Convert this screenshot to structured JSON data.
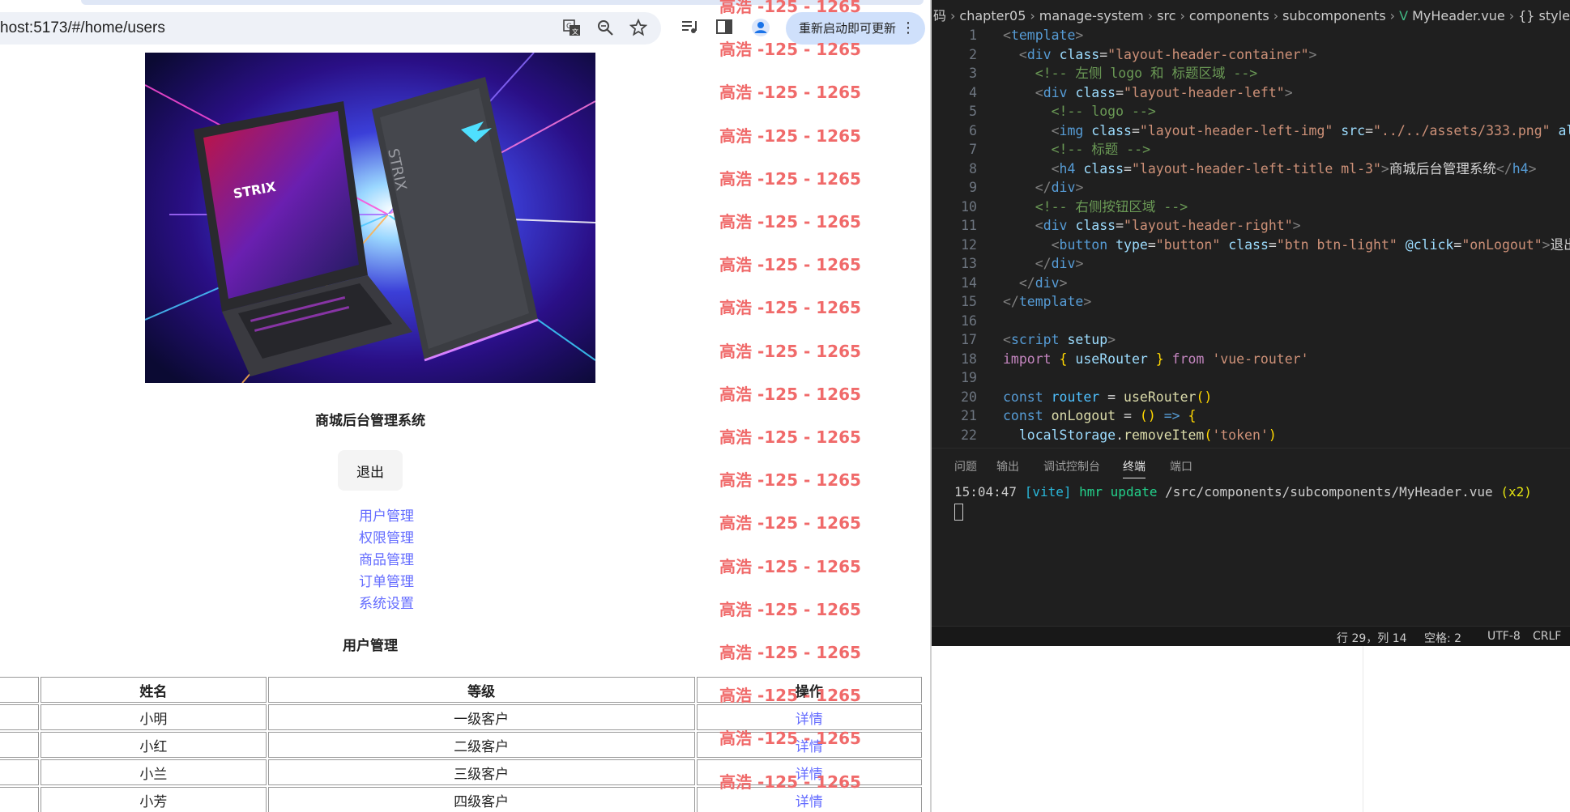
{
  "browser": {
    "url": "host:5173/#/home/users",
    "restart_label": "重新启动即可更新",
    "toolbar_icons": [
      "translate-icon",
      "zoom-icon",
      "star-icon",
      "media-icon",
      "sidebar-icon",
      "profile-icon",
      "more-icon"
    ]
  },
  "page": {
    "site_title": "商城后台管理系统",
    "logout_label": "退出",
    "menu": [
      "用户管理",
      "权限管理",
      "商品管理",
      "订单管理",
      "系统设置"
    ],
    "section_title": "用户管理",
    "table": {
      "headers": [
        "",
        "姓名",
        "等级",
        "操作"
      ],
      "rows": [
        {
          "id": "",
          "name": "小明",
          "level": "一级客户",
          "op": "详情"
        },
        {
          "id": "",
          "name": "小红",
          "level": "二级客户",
          "op": "详情"
        },
        {
          "id": "",
          "name": "小兰",
          "level": "三级客户",
          "op": "详情"
        },
        {
          "id": "",
          "name": "小芳",
          "level": "四级客户",
          "op": "详情"
        }
      ]
    }
  },
  "watermark": {
    "text": "高浩 -125 - 1265",
    "color": "#f06a6a"
  },
  "vscode": {
    "breadcrumb": [
      "码",
      "chapter05",
      "manage-system",
      "src",
      "components",
      "subcomponents",
      "MyHeader.vue",
      "{} style"
    ],
    "code_lines": [
      {
        "n": "1",
        "html": "<span class='t-punc'>&lt;</span><span class='t-tag'>template</span><span class='t-punc'>&gt;</span>"
      },
      {
        "n": "2",
        "html": "  <span class='t-punc'>&lt;</span><span class='t-tag'>div</span> <span class='t-attr'>class</span>=<span class='t-str'>\"layout-header-container\"</span><span class='t-punc'>&gt;</span>"
      },
      {
        "n": "3",
        "html": "    <span class='t-cmt'>&lt;!-- 左侧 logo 和 标题区域 --&gt;</span>"
      },
      {
        "n": "4",
        "html": "    <span class='t-punc'>&lt;</span><span class='t-tag'>div</span> <span class='t-attr'>class</span>=<span class='t-str'>\"layout-header-left\"</span><span class='t-punc'>&gt;</span>"
      },
      {
        "n": "5",
        "html": "      <span class='t-cmt'>&lt;!-- logo --&gt;</span>"
      },
      {
        "n": "6",
        "html": "      <span class='t-punc'>&lt;</span><span class='t-tag'>img</span> <span class='t-attr'>class</span>=<span class='t-str'>\"layout-header-left-img\"</span> <span class='t-attr'>src</span>=<span class='t-str'>\"../../assets/333.png\"</span> <span class='t-attr'>alt</span>="
      },
      {
        "n": "7",
        "html": "      <span class='t-cmt'>&lt;!-- 标题 --&gt;</span>"
      },
      {
        "n": "8",
        "html": "      <span class='t-punc'>&lt;</span><span class='t-tag'>h4</span> <span class='t-attr'>class</span>=<span class='t-str'>\"layout-header-left-title ml-3\"</span><span class='t-punc'>&gt;</span>商城后台管理系统<span class='t-punc'>&lt;/</span><span class='t-tag'>h4</span><span class='t-punc'>&gt;</span>"
      },
      {
        "n": "9",
        "html": "    <span class='t-punc'>&lt;/</span><span class='t-tag'>div</span><span class='t-punc'>&gt;</span>"
      },
      {
        "n": "10",
        "html": "    <span class='t-cmt'>&lt;!-- 右侧按钮区域 --&gt;</span>"
      },
      {
        "n": "11",
        "html": "    <span class='t-punc'>&lt;</span><span class='t-tag'>div</span> <span class='t-attr'>class</span>=<span class='t-str'>\"layout-header-right\"</span><span class='t-punc'>&gt;</span>"
      },
      {
        "n": "12",
        "html": "      <span class='t-punc'>&lt;</span><span class='t-tag'>button</span> <span class='t-attr'>type</span>=<span class='t-str'>\"button\"</span> <span class='t-attr'>class</span>=<span class='t-str'>\"btn btn-light\"</span> <span class='t-attr'>@click</span>=<span class='t-str'>\"onLogout\"</span><span class='t-punc'>&gt;</span>退出<span class='t-punc'>&lt;</span>"
      },
      {
        "n": "13",
        "html": "    <span class='t-punc'>&lt;/</span><span class='t-tag'>div</span><span class='t-punc'>&gt;</span>"
      },
      {
        "n": "14",
        "html": "  <span class='t-punc'>&lt;/</span><span class='t-tag'>div</span><span class='t-punc'>&gt;</span>"
      },
      {
        "n": "15",
        "html": "<span class='t-punc'>&lt;/</span><span class='t-tag'>template</span><span class='t-punc'>&gt;</span>"
      },
      {
        "n": "16",
        "html": ""
      },
      {
        "n": "17",
        "html": "<span class='t-punc'>&lt;</span><span class='t-tag'>script</span> <span class='t-attr'>setup</span><span class='t-punc'>&gt;</span>"
      },
      {
        "n": "18",
        "html": "<span class='t-kw'>import</span> <span class='t-brace'>{</span> <span class='t-attr'>useRouter</span> <span class='t-brace'>}</span> <span class='t-kw'>from</span> <span class='t-str'>'vue-router'</span>"
      },
      {
        "n": "19",
        "html": ""
      },
      {
        "n": "20",
        "html": "<span class='t-tag'>const</span> <span class='t-var'>router</span> = <span class='t-fn'>useRouter</span><span class='t-brace'>()</span>"
      },
      {
        "n": "21",
        "html": "<span class='t-tag'>const</span> <span class='t-fn'>onLogout</span> = <span class='t-brace'>()</span> <span class='t-tag'>=&gt;</span> <span class='t-brace'>{</span>"
      },
      {
        "n": "22",
        "html": "  <span class='t-attr'>localStorage</span>.<span class='t-fn'>removeItem</span><span class='t-brace'>(</span><span class='t-str'>'token'</span><span class='t-brace'>)</span>"
      }
    ],
    "panel_tabs": [
      "问题",
      "输出",
      "调试控制台",
      "终端",
      "端口"
    ],
    "active_tab": "终端",
    "terminal": {
      "time": "15:04:47",
      "tag": "[vite]",
      "msg": "hmr update",
      "path": "/src/components/subcomponents/MyHeader.vue",
      "count": "(x2)"
    },
    "status": {
      "position": "行 29，列 14",
      "spaces": "空格: 2",
      "encoding": "UTF-8",
      "eol": "CRLF"
    }
  }
}
